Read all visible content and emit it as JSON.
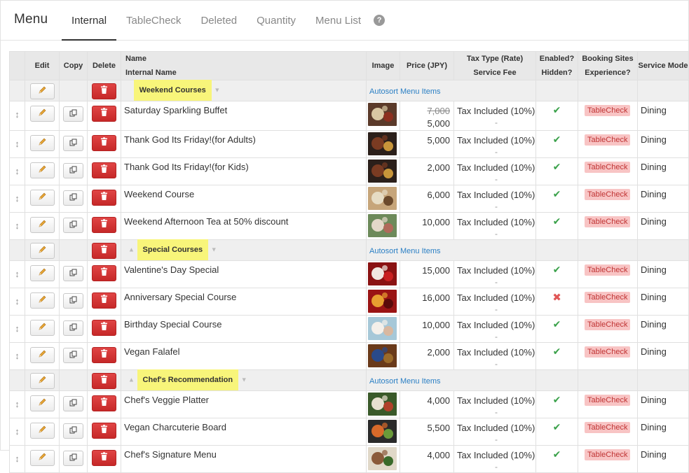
{
  "header": {
    "title": "Menu",
    "tabs": [
      "Internal",
      "TableCheck",
      "Deleted",
      "Quantity",
      "Menu List"
    ],
    "help": "?"
  },
  "columns": {
    "edit": "Edit",
    "copy": "Copy",
    "delete": "Delete",
    "name": "Name",
    "internal_name": "Internal Name",
    "image": "Image",
    "price": "Price (JPY)",
    "tax_type": "Tax Type (Rate)",
    "service_fee": "Service Fee",
    "enabled": "Enabled?",
    "hidden": "Hidden?",
    "booking_sites": "Booking Sites",
    "experience": "Experience?",
    "service_mode": "Service Mode"
  },
  "autosort_label": "Autosort Menu Items",
  "groups": [
    {
      "label": "Weekend Courses",
      "items": [
        {
          "name": "Saturday Sparkling Buffet",
          "old_price": "7,000",
          "price": "5,000",
          "tax": "Tax Included (10%)",
          "fee": "-",
          "enabled": true,
          "site": "TableCheck",
          "mode": "Dining",
          "colors": [
            "#5b3a2a",
            "#d9c7a3",
            "#8c2f1f"
          ]
        },
        {
          "name": "Thank God Its Friday!(for Adults)",
          "price": "5,000",
          "tax": "Tax Included (10%)",
          "fee": "-",
          "enabled": true,
          "site": "TableCheck",
          "mode": "Dining",
          "colors": [
            "#2b1f1a",
            "#7a3b22",
            "#c8953a"
          ]
        },
        {
          "name": "Thank God Its Friday!(for Kids)",
          "price": "2,000",
          "tax": "Tax Included (10%)",
          "fee": "-",
          "enabled": true,
          "site": "TableCheck",
          "mode": "Dining",
          "colors": [
            "#2b1f1a",
            "#7a3b22",
            "#c8953a"
          ]
        },
        {
          "name": "Weekend Course",
          "price": "6,000",
          "tax": "Tax Included (10%)",
          "fee": "-",
          "enabled": true,
          "site": "TableCheck",
          "mode": "Dining",
          "colors": [
            "#c6a57a",
            "#e6dcc4",
            "#6b4a2c"
          ]
        },
        {
          "name": "Weekend Afternoon Tea at 50% discount",
          "price": "10,000",
          "tax": "Tax Included (10%)",
          "fee": "-",
          "enabled": true,
          "site": "TableCheck",
          "mode": "Dining",
          "colors": [
            "#6d8a5a",
            "#e4d8c8",
            "#b06a5a"
          ]
        }
      ]
    },
    {
      "label": "Special Courses",
      "items": [
        {
          "name": "Valentine's Day Special",
          "price": "15,000",
          "tax": "Tax Included (10%)",
          "fee": "-",
          "enabled": true,
          "site": "TableCheck",
          "mode": "Dining",
          "colors": [
            "#8a1212",
            "#f0e8e0",
            "#c82020"
          ]
        },
        {
          "name": "Anniversary Special Course",
          "price": "16,000",
          "tax": "Tax Included (10%)",
          "fee": "-",
          "enabled": false,
          "site": "TableCheck",
          "mode": "Dining",
          "colors": [
            "#9a1414",
            "#e8a030",
            "#5a0a0a"
          ]
        },
        {
          "name": "Birthday Special Course",
          "price": "10,000",
          "tax": "Tax Included (10%)",
          "fee": "-",
          "enabled": true,
          "site": "TableCheck",
          "mode": "Dining",
          "colors": [
            "#a6c8d8",
            "#f4f0ea",
            "#d8b8a0"
          ]
        },
        {
          "name": "Vegan Falafel",
          "price": "2,000",
          "tax": "Tax Included (10%)",
          "fee": "-",
          "enabled": true,
          "site": "TableCheck",
          "mode": "Dining",
          "colors": [
            "#6a3a1a",
            "#2a4a8a",
            "#9a6a2a"
          ]
        }
      ]
    },
    {
      "label": "Chef's Recommendation",
      "items": [
        {
          "name": "Chef's Veggie Platter",
          "price": "4,000",
          "tax": "Tax Included (10%)",
          "fee": "-",
          "enabled": true,
          "site": "TableCheck",
          "mode": "Dining",
          "colors": [
            "#3a5a2a",
            "#e8e0d0",
            "#b0402a"
          ]
        },
        {
          "name": "Vegan Charcuterie Board",
          "price": "5,500",
          "tax": "Tax Included (10%)",
          "fee": "-",
          "enabled": true,
          "site": "TableCheck",
          "mode": "Dining",
          "colors": [
            "#2a2a2a",
            "#d86a2a",
            "#6a9a3a"
          ]
        },
        {
          "name": "Chef's Signature Menu",
          "price": "4,000",
          "tax": "Tax Included (10%)",
          "fee": "-",
          "enabled": true,
          "site": "TableCheck",
          "mode": "Dining",
          "colors": [
            "#e0d8c8",
            "#8a5a3a",
            "#3a6a2a"
          ]
        }
      ]
    }
  ]
}
